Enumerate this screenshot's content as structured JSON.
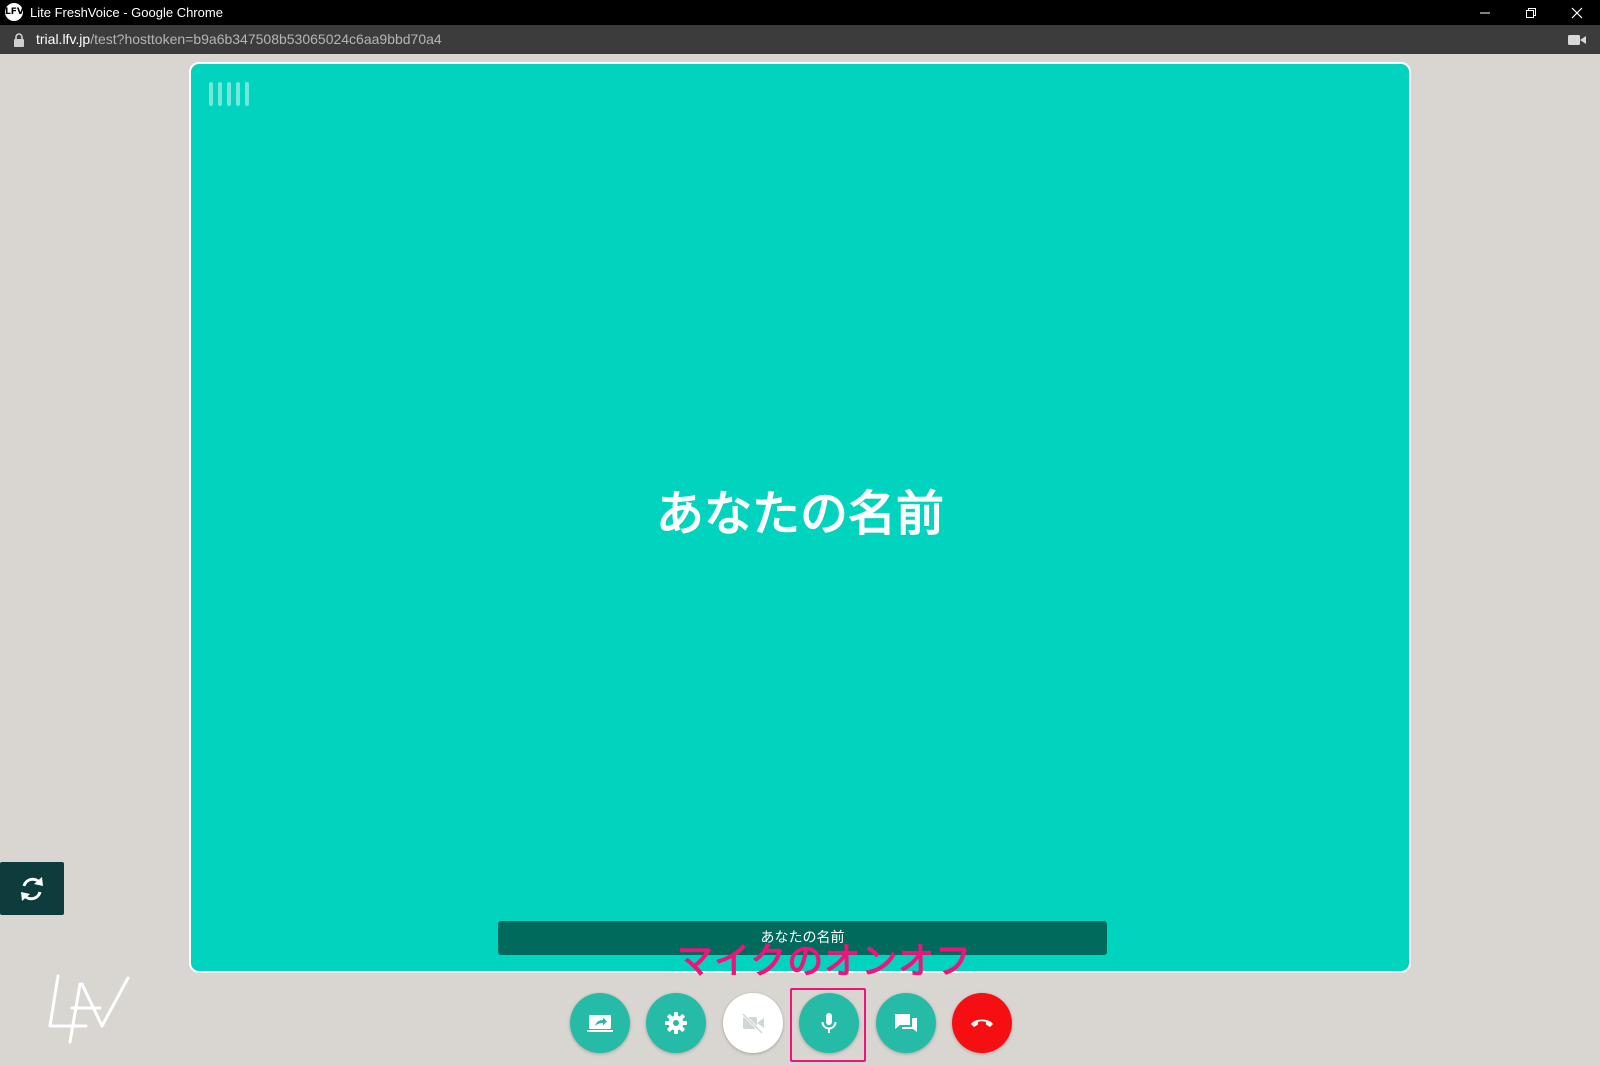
{
  "window": {
    "icon_text": "LFV",
    "title": "Lite FreshVoice - Google Chrome"
  },
  "address_bar": {
    "host": "trial.lfv.jp",
    "path": "/test?hosttoken=b9a6b347508b53065024c6aa9bbd70a4"
  },
  "video_tile": {
    "participant_name": "あなたの名前",
    "name_label": "あなたの名前",
    "background_color": "#00d3be"
  },
  "annotation": {
    "label": "マイクのオンオフ",
    "color": "#f2137a"
  },
  "controls": [
    {
      "name": "screen-share",
      "icon": "screen-share-icon"
    },
    {
      "name": "settings",
      "icon": "gear-icon"
    },
    {
      "name": "camera-toggle",
      "icon": "video-off-icon"
    },
    {
      "name": "mic-toggle",
      "icon": "microphone-icon"
    },
    {
      "name": "chat",
      "icon": "chat-icon"
    },
    {
      "name": "hang-up",
      "icon": "phone-hangup-icon"
    }
  ],
  "colors": {
    "accent": "#25bba6",
    "hangup": "#f50f12",
    "page_background": "#d9d6d2"
  }
}
